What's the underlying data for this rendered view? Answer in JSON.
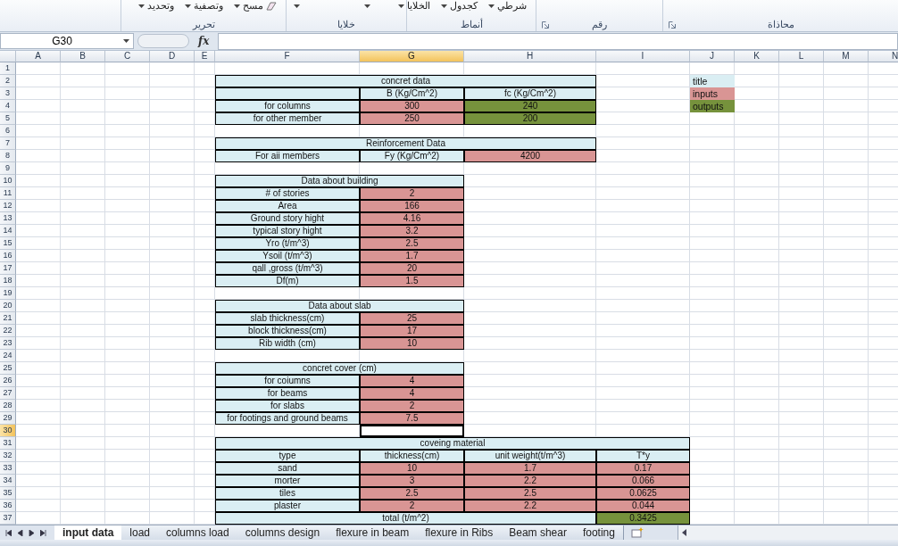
{
  "ribbon": {
    "groups": [
      {
        "label": "محاذاة",
        "launcher": true
      },
      {
        "label": "رقم",
        "launcher": true
      },
      {
        "label": "أنماط",
        "items": [
          {
            "text": "شرطي",
            "kind": "dropdown"
          },
          {
            "text": "كجدول",
            "kind": "dropdown"
          },
          {
            "text": "الخلايا",
            "kind": "dropdown"
          }
        ]
      },
      {
        "label": "خلايا",
        "items": [
          {
            "kind": "caret"
          },
          {
            "kind": "caret"
          }
        ]
      },
      {
        "label": "تحرير",
        "items": [
          {
            "text": "مسح",
            "kind": "eraser"
          },
          {
            "text": "وتصفية",
            "kind": "dropdown"
          },
          {
            "text": "وتحديد",
            "kind": "dropdown"
          }
        ]
      }
    ]
  },
  "formula_bar": {
    "name_box": "G30",
    "function_button": "fx"
  },
  "columns": [
    {
      "label": "A",
      "selected": false
    },
    {
      "label": "B",
      "selected": false
    },
    {
      "label": "C",
      "selected": false
    },
    {
      "label": "D",
      "selected": false
    },
    {
      "label": "E",
      "selected": false
    },
    {
      "label": "F",
      "selected": false
    },
    {
      "label": "G",
      "selected": true
    },
    {
      "label": "H",
      "selected": false
    },
    {
      "label": "I",
      "selected": false
    },
    {
      "label": "J",
      "selected": false
    },
    {
      "label": "K",
      "selected": false
    },
    {
      "label": "L",
      "selected": false
    },
    {
      "label": "M",
      "selected": false
    },
    {
      "label": "N",
      "selected": false
    }
  ],
  "row_headers": [
    {
      "number": "1",
      "selected": false
    },
    {
      "number": "2",
      "selected": false
    },
    {
      "number": "3",
      "selected": false
    },
    {
      "number": "4",
      "selected": false
    },
    {
      "number": "5",
      "selected": false
    },
    {
      "number": "6",
      "selected": false
    },
    {
      "number": "7",
      "selected": false
    },
    {
      "number": "8",
      "selected": false
    },
    {
      "number": "9",
      "selected": false
    },
    {
      "number": "10",
      "selected": false
    },
    {
      "number": "11",
      "selected": false
    },
    {
      "number": "12",
      "selected": false
    },
    {
      "number": "13",
      "selected": false
    },
    {
      "number": "14",
      "selected": false
    },
    {
      "number": "15",
      "selected": false
    },
    {
      "number": "16",
      "selected": false
    },
    {
      "number": "17",
      "selected": false
    },
    {
      "number": "18",
      "selected": false
    },
    {
      "number": "19",
      "selected": false
    },
    {
      "number": "20",
      "selected": false
    },
    {
      "number": "21",
      "selected": false
    },
    {
      "number": "22",
      "selected": false
    },
    {
      "number": "23",
      "selected": false
    },
    {
      "number": "24",
      "selected": false
    },
    {
      "number": "25",
      "selected": false
    },
    {
      "number": "26",
      "selected": false
    },
    {
      "number": "27",
      "selected": false
    },
    {
      "number": "28",
      "selected": false
    },
    {
      "number": "29",
      "selected": false
    },
    {
      "number": "30",
      "selected": true
    },
    {
      "number": "31",
      "selected": false
    },
    {
      "number": "32",
      "selected": false
    },
    {
      "number": "33",
      "selected": false
    },
    {
      "number": "34",
      "selected": false
    },
    {
      "number": "35",
      "selected": false
    },
    {
      "number": "36",
      "selected": false
    },
    {
      "number": "37",
      "selected": false
    }
  ],
  "tables": [
    {
      "title": {
        "text": "concret data",
        "color": "#daeef3"
      },
      "rows": [
        [
          {
            "color": "#daeef3"
          },
          {
            "text": "B (Kg/Cm^2)",
            "color": "#daeef3"
          },
          {
            "text": "fc (Kg/Cm^2)",
            "color": "#daeef3"
          }
        ],
        [
          {
            "text": "for columns",
            "color": "#daeef3"
          },
          {
            "text": "300",
            "color": "#d99594"
          },
          {
            "text": "240",
            "color": "#76923c"
          }
        ],
        [
          {
            "text": "for other member",
            "color": "#daeef3"
          },
          {
            "text": "250",
            "color": "#d99594"
          },
          {
            "text": "200",
            "color": "#76923c"
          }
        ]
      ]
    },
    {
      "title": {
        "text": "Reinforcement Data",
        "color": "#daeef3"
      },
      "rows": [
        [
          {
            "text": "For aii members",
            "color": "#daeef3"
          },
          {
            "text": "Fy (Kg/Cm^2)",
            "color": "#daeef3"
          },
          {
            "text": "4200",
            "color": "#d99594"
          }
        ]
      ]
    },
    {
      "title": {
        "text": "Data about building",
        "color": "#daeef3"
      },
      "rows": [
        [
          {
            "text": "# of stories",
            "color": "#daeef3"
          },
          {
            "text": "2",
            "color": "#d99594"
          }
        ],
        [
          {
            "text": "Area",
            "color": "#daeef3"
          },
          {
            "text": "166",
            "color": "#d99594"
          }
        ],
        [
          {
            "text": "Ground story hight",
            "color": "#daeef3"
          },
          {
            "text": "4.16",
            "color": "#d99594"
          }
        ],
        [
          {
            "text": "typical story hight",
            "color": "#daeef3"
          },
          {
            "text": "3.2",
            "color": "#d99594"
          }
        ],
        [
          {
            "text": "Yro (t/m^3)",
            "color": "#daeef3"
          },
          {
            "text": "2.5",
            "color": "#d99594"
          }
        ],
        [
          {
            "text": "Ysoil (t/m^3)",
            "color": "#daeef3"
          },
          {
            "text": "1.7",
            "color": "#d99594"
          }
        ],
        [
          {
            "text": "qall ,gross (t/m^3)",
            "color": "#daeef3"
          },
          {
            "text": "20",
            "color": "#d99594"
          }
        ],
        [
          {
            "text": "Df(m)",
            "color": "#daeef3"
          },
          {
            "text": "1.5",
            "color": "#d99594"
          }
        ]
      ]
    },
    {
      "title": {
        "text": "Data about slab",
        "color": "#daeef3"
      },
      "rows": [
        [
          {
            "text": "slab thickness(cm)",
            "color": "#daeef3"
          },
          {
            "text": "25",
            "color": "#d99594"
          }
        ],
        [
          {
            "text": "block thickness(cm)",
            "color": "#daeef3"
          },
          {
            "text": "17",
            "color": "#d99594"
          }
        ],
        [
          {
            "text": "Rib width (cm)",
            "color": "#daeef3"
          },
          {
            "text": "10",
            "color": "#d99594"
          }
        ]
      ]
    },
    {
      "title": {
        "text": "concret cover (cm)",
        "color": "#daeef3"
      },
      "rows": [
        [
          {
            "text": "for coiumns",
            "color": "#daeef3"
          },
          {
            "text": "4",
            "color": "#d99594"
          }
        ],
        [
          {
            "text": "for beams",
            "color": "#daeef3"
          },
          {
            "text": "4",
            "color": "#d99594"
          }
        ],
        [
          {
            "text": "for slabs",
            "color": "#daeef3"
          },
          {
            "text": "2",
            "color": "#d99594"
          }
        ],
        [
          {
            "text": "for footings and ground beams",
            "color": "#daeef3"
          },
          {
            "text": "7.5",
            "color": "#d99594"
          }
        ]
      ]
    },
    {
      "title": {
        "text": "coveing material",
        "color": "#daeef3"
      },
      "rows": [
        [
          {
            "text": "type",
            "color": "#daeef3"
          },
          {
            "text": "thickness(cm)",
            "color": "#daeef3"
          },
          {
            "text": "unit weight(t/m^3)",
            "color": "#daeef3"
          },
          {
            "text": "T*y",
            "color": "#daeef3"
          }
        ],
        [
          {
            "text": "sand",
            "color": "#daeef3"
          },
          {
            "text": "10",
            "color": "#d99594"
          },
          {
            "text": "1.7",
            "color": "#d99594"
          },
          {
            "text": "0.17",
            "color": "#d99594"
          }
        ],
        [
          {
            "text": "morter",
            "color": "#daeef3"
          },
          {
            "text": "3",
            "color": "#d99594"
          },
          {
            "text": "2.2",
            "color": "#d99594"
          },
          {
            "text": "0.066",
            "color": "#d99594"
          }
        ],
        [
          {
            "text": "tiles",
            "color": "#daeef3"
          },
          {
            "text": "2.5",
            "color": "#d99594"
          },
          {
            "text": "2.5",
            "color": "#d99594"
          },
          {
            "text": "0.0625",
            "color": "#d99594"
          }
        ],
        [
          {
            "text": "plaster",
            "color": "#daeef3"
          },
          {
            "text": "2",
            "color": "#d99594"
          },
          {
            "text": "2.2",
            "color": "#d99594"
          },
          {
            "text": "0.044",
            "color": "#d99594"
          }
        ]
      ],
      "total": {
        "label": {
          "text": "total (t/m^2)",
          "color": "#daeef3"
        },
        "value": {
          "text": "0.3425",
          "color": "#76923c"
        }
      }
    }
  ],
  "legend": [
    {
      "text": "title",
      "color": "#daeef3"
    },
    {
      "text": "inputs",
      "color": "#d99594"
    },
    {
      "text": "outputs",
      "color": "#76923c"
    }
  ],
  "sheet_tabs": [
    {
      "label": "input data",
      "selected": true
    },
    {
      "label": "load",
      "selected": false
    },
    {
      "label": "columns load",
      "selected": false
    },
    {
      "label": "columns design",
      "selected": false
    },
    {
      "label": "flexure in beam",
      "selected": false
    },
    {
      "label": "flexure in Ribs",
      "selected": false
    },
    {
      "label": "Beam shear",
      "selected": false
    },
    {
      "label": "footing",
      "selected": false
    }
  ]
}
